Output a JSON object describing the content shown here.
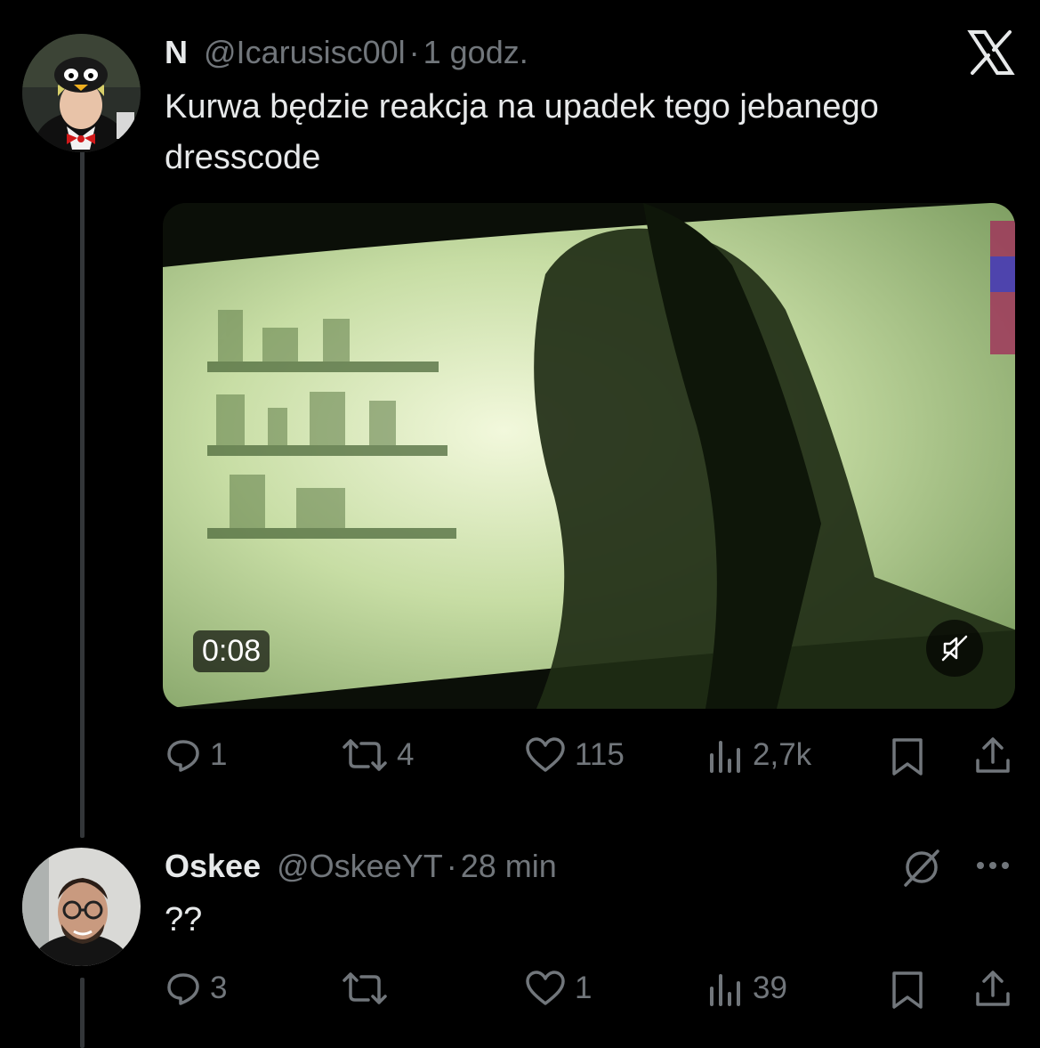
{
  "tweet1": {
    "name": "N",
    "handle": "@Icarusisc00l",
    "separator": "·",
    "time": "1 godz.",
    "text": "Kurwa będzie reakcja na upadek tego jebanego dresscode",
    "video": {
      "duration": "0:08",
      "muted": true
    },
    "actions": {
      "replies": "1",
      "reposts": "4",
      "likes": "115",
      "views": "2,7k"
    }
  },
  "tweet2": {
    "name": "Oskee",
    "handle": "@OskeeYT",
    "separator": "·",
    "time": "28 min",
    "text": "??",
    "actions": {
      "replies": "3",
      "reposts": "",
      "likes": "1",
      "views": "39"
    }
  },
  "icons": [
    "x-logo-icon",
    "grok-icon",
    "more-icon",
    "reply-icon",
    "repost-icon",
    "like-icon",
    "views-icon",
    "bookmark-icon",
    "share-icon",
    "muted-icon"
  ],
  "colors": {
    "background": "#000000",
    "text": "#e7e9ea",
    "muted": "#71767b",
    "video_tint": "#8fb270"
  }
}
